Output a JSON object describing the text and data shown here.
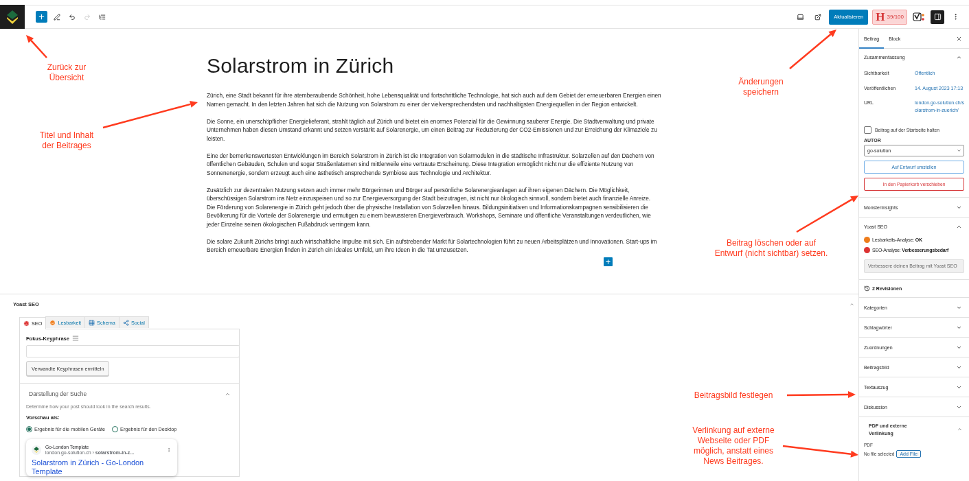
{
  "toolbar": {
    "tools": [
      {
        "kind": "inserter",
        "disabled": false
      },
      {
        "kind": "tools",
        "disabled": false
      },
      {
        "kind": "undo",
        "disabled": false
      },
      {
        "kind": "redo",
        "disabled": true
      },
      {
        "kind": "outline",
        "disabled": false
      }
    ],
    "actions": [
      {
        "kind": "preview",
        "selected": false
      },
      {
        "kind": "view",
        "selected": false
      }
    ],
    "update_button": "Aktualisieren",
    "score": {
      "letter": "H",
      "value": "39/100"
    },
    "extras": [
      {
        "kind": "yoast",
        "selected": false
      },
      {
        "kind": "settings",
        "selected": true
      },
      {
        "kind": "more",
        "selected": false
      }
    ]
  },
  "editor": {
    "title": "Solarstrom in Zürich",
    "paragraphs": [
      {
        "lines": [
          "Zürich, eine Stadt bekannt für ihre atemberaubende Schönheit, hohe Lebensqualität und fortschrittliche Technologie, hat sich auch auf dem Gebiet der erneuerbaren Energien einen Namen gemacht. In den letzten Jahren hat sich die Nutzung von Solarstrom zu einer der vielversprechendsten und nachhaltigsten Energiequellen in der Region entwickelt."
        ]
      },
      {
        "lines": [
          "Die Sonne, ein unerschöpflicher Energielieferant, strahlt täglich auf Zürich und bietet ein enormes Potenzial für die Gewinnung sauberer Energie. Die Stadtverwaltung und private Unternehmen haben diesen Umstand erkannt und setzen verstärkt auf Solarenergie, um einen Beitrag zur Reduzierung der CO2-Emissionen und zur Erreichung der Klimaziele zu leisten."
        ]
      },
      {
        "lines": [
          "Eine der bemerkenswertesten Entwicklungen im Bereich Solarstrom in Zürich ist die Integration von Solarmodulen in die städtische Infrastruktur. Solarzellen auf den Dächern von öffentlichen Gebäuden, Schulen und sogar Straßenlaternen sind mittlerweile eine vertraute Erscheinung. Diese Integration ermöglicht nicht nur die effiziente Nutzung von Sonnenenergie, sondern erzeugt auch eine ästhetisch ansprechende Symbiose aus Technologie und Architektur."
        ]
      },
      {
        "lines": [
          "Zusätzlich zur dezentralen Nutzung setzen auch immer mehr Bürgerinnen und Bürger auf persönliche Solarenergieanlagen auf ihren eigenen Dächern. Die Möglichkeit, überschüssigen Solarstrom ins Netz einzuspeisen und so zur Energieversorgung der Stadt beizutragen, ist nicht nur ökologisch sinnvoll, sondern bietet auch finanzielle Anreize.",
          "Die Förderung von Solarenergie in Zürich geht jedoch über die physische Installation von Solarzellen hinaus. Bildungsinitiativen und Informationskampagnen sensibilisieren die Bevölkerung für die Vorteile der Solarenergie und ermutigen zu einem bewussteren Energieverbrauch. Workshops, Seminare und öffentliche Veranstaltungen verdeutlichen, wie jeder Einzelne seinen ökologischen Fußabdruck verringern kann."
        ]
      },
      {
        "lines": [
          "Die solare Zukunft Zürichs bringt auch wirtschaftliche Impulse mit sich. Ein aufstrebender Markt für Solartechnologien führt zu neuen Arbeitsplätzen und Innovationen. Start-ups im Bereich erneuerbare Energien finden in Zürich ein ideales Umfeld, um ihre Ideen in die Tat umzusetzen."
        ]
      }
    ]
  },
  "yoast_panel": {
    "title": "Yoast SEO",
    "expanded": true,
    "tabs": [
      {
        "label": "SEO",
        "kind": "score",
        "color": "#dc3232",
        "selected": true
      },
      {
        "label": "Lesbarkeit",
        "kind": "score",
        "color": "#ee7c1b",
        "selected": false
      },
      {
        "label": "Schema",
        "kind": "schema",
        "selected": false
      },
      {
        "label": "Social",
        "kind": "social",
        "selected": false
      }
    ],
    "focus_keyphrase": {
      "label": "Fokus-Keyphrase",
      "button": "Verwandte Keyphrasen ermitteln"
    },
    "search_appearance": {
      "title": "Darstellung der Suche",
      "expanded": true,
      "description": "Determine how your post should look in the search results.",
      "preview_label": "Vorschau als:",
      "options": [
        {
          "label": "Ergebnis für die mobilen Geräte",
          "selected": true
        },
        {
          "label": "Ergebnis für den Desktop",
          "selected": false
        }
      ],
      "preview": {
        "site": "Go-London Template",
        "url": "london.go-solution.ch › **solarstrom-in-z...**",
        "title": "Solarstrom in Zürich - Go-London Template"
      }
    }
  },
  "sidebar": {
    "tabs": [
      {
        "label": "Beitrag",
        "selected": true
      },
      {
        "label": "Block",
        "selected": false
      }
    ],
    "summary": {
      "title": "Zusammenfassung",
      "expanded": true,
      "fields": [
        {
          "label": "Sichtbarkeit",
          "value": "Öffentlich"
        },
        {
          "label": "Veröffentlichen",
          "value": "14. August 2023 17:13"
        },
        {
          "label": "URL",
          "value": "london.go-solution.ch/solarstrom-in-zuerich/"
        }
      ],
      "sticky": {
        "label": "Beitrag auf der Startseite halten",
        "checked": false
      },
      "author": {
        "label": "AUTOR",
        "value": "go-solution"
      },
      "draft_button": "Auf Entwurf umstellen",
      "trash_button": "In den Papierkorb verschieben"
    },
    "panels": [
      {
        "kind": "collapsible",
        "title": "MonsterInsights",
        "expanded": false
      },
      {
        "kind": "yoast",
        "title": "Yoast SEO",
        "expanded": true,
        "analyses": [
          {
            "text": "Lesbarkeits-Analyse: **OK**",
            "color": "#ee7c1b"
          },
          {
            "text": "SEO-Analyse: **Verbesserungsbedarf**",
            "color": "#dc3232"
          }
        ],
        "button": "Verbessere deinen Beitrag mit Yoast SEO"
      },
      {
        "kind": "revisions",
        "title": "2 Revisionen"
      },
      {
        "kind": "collapsible",
        "title": "Kategorien",
        "expanded": false
      },
      {
        "kind": "collapsible",
        "title": "Schlagwörter",
        "expanded": false
      },
      {
        "kind": "collapsible",
        "title": "Zuordnungen",
        "expanded": false
      },
      {
        "kind": "collapsible",
        "title": "Beitragsbild",
        "expanded": false
      },
      {
        "kind": "collapsible",
        "title": "Textauszug",
        "expanded": false
      },
      {
        "kind": "collapsible",
        "title": "Diskussion",
        "expanded": false
      },
      {
        "kind": "pdf",
        "title": "PDF und externe Verlinkung",
        "expanded": true,
        "field_label": "PDF",
        "file_status": "No file selected",
        "button": "Add File"
      }
    ]
  },
  "annotations": [
    {
      "lines": [
        "Zurück zur",
        "Übersicht"
      ]
    },
    {
      "lines": [
        "Titel und Inhalt",
        "der Beitrages"
      ]
    },
    {
      "lines": [
        "Änderungen",
        "speichern"
      ]
    },
    {
      "lines": [
        "Beitrag löschen oder auf",
        "Entwurf (nicht sichtbar) setzen."
      ]
    },
    {
      "lines": [
        "Beitragsbild festlegen"
      ]
    },
    {
      "lines": [
        "Verlinkung auf externe",
        "Webseite oder PDF",
        "möglich, anstatt eines",
        "News Beitrages."
      ]
    }
  ]
}
